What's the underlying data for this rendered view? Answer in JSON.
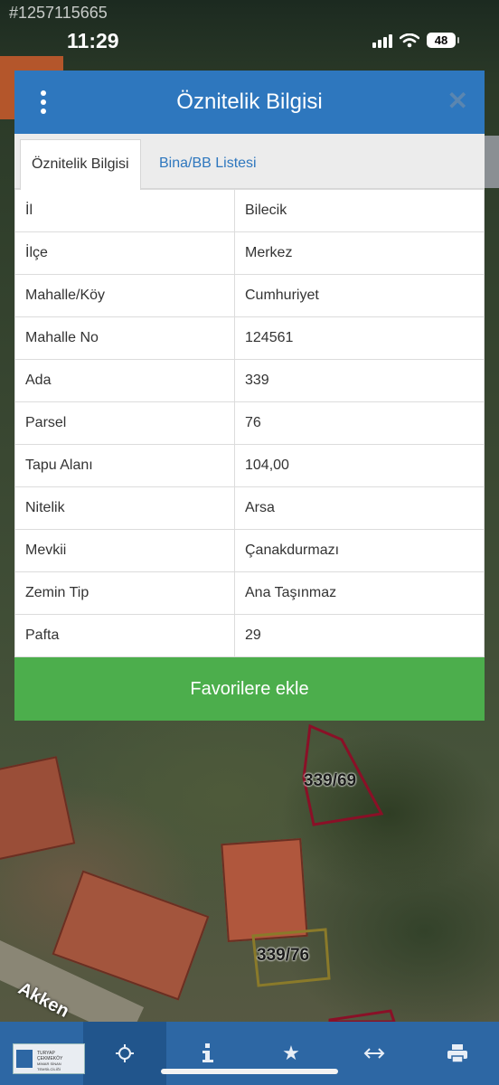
{
  "status_bar": {
    "listing_id": "#1257115665",
    "time": "11:29",
    "battery": "48"
  },
  "dialog": {
    "title": "Öznitelik Bilgisi",
    "tabs": [
      {
        "label": "Öznitelik Bilgisi",
        "active": true
      },
      {
        "label": "Bina/BB Listesi",
        "active": false
      }
    ],
    "rows": [
      {
        "key": "İl",
        "value": "Bilecik"
      },
      {
        "key": "İlçe",
        "value": "Merkez"
      },
      {
        "key": "Mahalle/Köy",
        "value": "Cumhuriyet"
      },
      {
        "key": "Mahalle No",
        "value": "124561"
      },
      {
        "key": "Ada",
        "value": "339"
      },
      {
        "key": "Parsel",
        "value": "76"
      },
      {
        "key": "Tapu Alanı",
        "value": "104,00"
      },
      {
        "key": "Nitelik",
        "value": "Arsa"
      },
      {
        "key": "Mevkii",
        "value": "Çanakdurmazı"
      },
      {
        "key": "Zemin Tip",
        "value": "Ana Taşınmaz"
      },
      {
        "key": "Pafta",
        "value": "29"
      }
    ],
    "favorite_button": "Favorilere ekle"
  },
  "map": {
    "parcel_labels": [
      "339/69",
      "339/76"
    ],
    "road_label": "Akken"
  },
  "toolbar": {
    "items": [
      "logo",
      "crosshair-icon",
      "info-icon",
      "star-icon",
      "measure-icon",
      "print-icon"
    ],
    "active": "crosshair-icon",
    "logo_text": "TURYAP ÇEKMEKÖY MİMAR SİNAN TEMSİLCİLİĞİ"
  },
  "colors": {
    "header_blue": "#2e77be",
    "button_green": "#4cae4c",
    "toolbar_blue": "#2d67a4"
  }
}
